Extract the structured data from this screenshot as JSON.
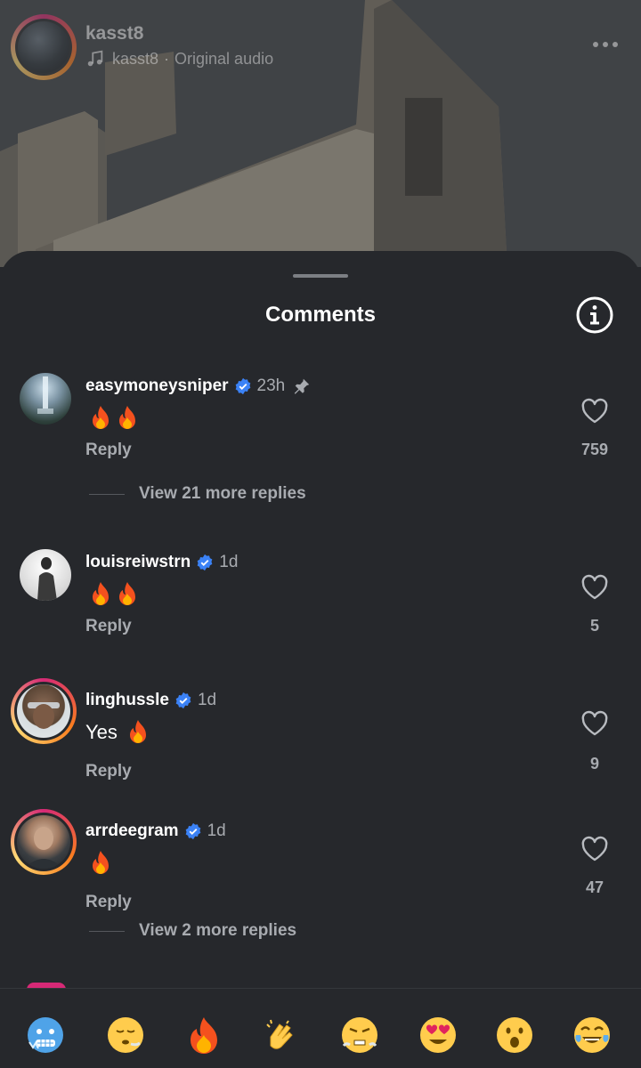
{
  "poster": {
    "username": "kasst8",
    "audio_owner": "kasst8",
    "audio_separator": "·",
    "audio_title": "Original audio"
  },
  "sheet": {
    "title": "Comments"
  },
  "comments": [
    {
      "username": "easymoneysniper",
      "verified": true,
      "time": "23h",
      "pinned": true,
      "text": "",
      "emoji": [
        "fire",
        "fire"
      ],
      "reply_label": "Reply",
      "likes": "759",
      "view_replies": "View 21 more replies"
    },
    {
      "username": "louisreiwstrn",
      "verified": true,
      "time": "1d",
      "pinned": false,
      "text": "",
      "emoji": [
        "fire",
        "fire"
      ],
      "reply_label": "Reply",
      "likes": "5"
    },
    {
      "username": "linghussle",
      "verified": true,
      "time": "1d",
      "pinned": false,
      "text": "Yes",
      "emoji": [
        "fire"
      ],
      "reply_label": "Reply",
      "likes": "9"
    },
    {
      "username": "arrdeegram",
      "verified": true,
      "time": "1d",
      "pinned": false,
      "text": "",
      "emoji": [
        "fire"
      ],
      "reply_label": "Reply",
      "likes": "47",
      "view_replies": "View 2 more replies"
    }
  ],
  "emoji_bar": [
    "cold-face",
    "face-exhaling",
    "fire",
    "clapping-hands",
    "face-with-steam",
    "heart-eyes",
    "face-open-mouth",
    "tears-of-joy"
  ],
  "colors": {
    "sheet_bg": "#26282c",
    "muted_text": "#a8abb0",
    "verified_blue": "#3b82f6",
    "story_ring": [
      "#d62976",
      "#fa7e1e",
      "#feda75"
    ]
  }
}
